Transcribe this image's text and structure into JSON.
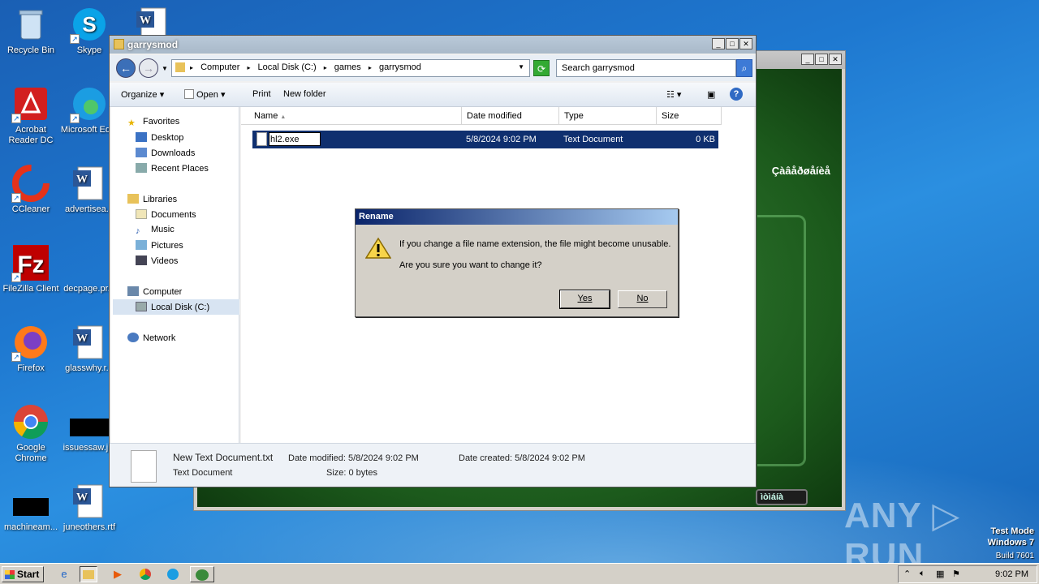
{
  "desktop": {
    "icons": [
      {
        "label": "Recycle Bin"
      },
      {
        "label": "Skype"
      },
      {
        "label": "Acrobat Reader DC"
      },
      {
        "label": "Microsoft Ed..."
      },
      {
        "label": "CCleaner"
      },
      {
        "label": "advertisea..."
      },
      {
        "label": "FileZilla Client"
      },
      {
        "label": "decpage.pr..."
      },
      {
        "label": "Firefox"
      },
      {
        "label": "glasswhy.r..."
      },
      {
        "label": "Google Chrome"
      },
      {
        "label": "issuessaw.j..."
      },
      {
        "label": "machineam..."
      },
      {
        "label": "juneothers.rtf"
      }
    ],
    "watermark": {
      "line1": "Test Mode",
      "line2": "Windows 7",
      "line3": "Build 7601"
    },
    "brand": "ANY ▷ RUN"
  },
  "game_window": {
    "text_right": "Çàâåðøåíèå",
    "button": "ìòìáíà"
  },
  "explorer": {
    "title": "garrysmod",
    "breadcrumb": [
      "Computer",
      "Local Disk (C:)",
      "games",
      "garrysmod"
    ],
    "search_placeholder": "Search garrysmod",
    "toolbar": {
      "organize": "Organize",
      "open": "Open",
      "print": "Print",
      "new_folder": "New folder"
    },
    "nav": {
      "favorites": "Favorites",
      "desktop": "Desktop",
      "downloads": "Downloads",
      "recent": "Recent Places",
      "libraries": "Libraries",
      "documents": "Documents",
      "music": "Music",
      "pictures": "Pictures",
      "videos": "Videos",
      "computer": "Computer",
      "local_disk": "Local Disk (C:)",
      "network": "Network"
    },
    "columns": {
      "name": "Name",
      "date": "Date modified",
      "type": "Type",
      "size": "Size"
    },
    "rows": [
      {
        "name": "hl2.exe",
        "date": "5/8/2024 9:02 PM",
        "type": "Text Document",
        "size": "0 KB"
      }
    ],
    "details": {
      "filename": "New Text Document.txt",
      "date_modified": "Date modified: 5/8/2024 9:02 PM",
      "date_created": "Date created: 5/8/2024 9:02 PM",
      "type": "Text Document",
      "size": "Size: 0 bytes"
    }
  },
  "dialog": {
    "title": "Rename",
    "message1": "If you change a file name extension, the file might become unusable.",
    "message2": "Are you sure you want to change it?",
    "yes": "Yes",
    "no": "No"
  },
  "taskbar": {
    "start": "Start",
    "clock": "9:02 PM"
  }
}
